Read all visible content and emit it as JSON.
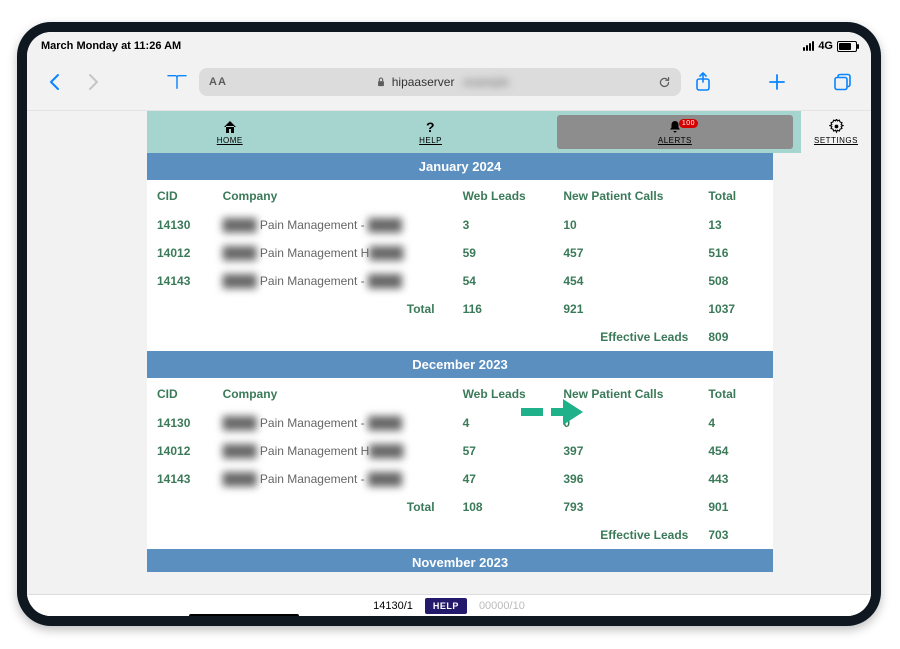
{
  "status": {
    "clock": "March Monday at 11:26 AM",
    "network": "4G"
  },
  "browser": {
    "domain": "hipaaserver"
  },
  "nav": {
    "home": "HOME",
    "help": "HELP",
    "alerts": "ALERTS",
    "alerts_badge": "100",
    "settings": "SETTINGS"
  },
  "columns": {
    "cid": "CID",
    "company": "Company",
    "web_leads": "Web Leads",
    "new_patient_calls": "New Patient Calls",
    "total": "Total"
  },
  "totals_label": "Total",
  "effective_label": "Effective Leads",
  "months": [
    {
      "title": "January 2024",
      "rows": [
        {
          "cid": "14130",
          "company_prefix": "████",
          "company_mid": " Pain Management - ",
          "company_suffix": "████",
          "web": "3",
          "new": "10",
          "total": "13"
        },
        {
          "cid": "14012",
          "company_prefix": "████",
          "company_mid": " Pain Management H",
          "company_suffix": "████",
          "web": "59",
          "new": "457",
          "total": "516"
        },
        {
          "cid": "14143",
          "company_prefix": "████",
          "company_mid": " Pain Management - ",
          "company_suffix": "████",
          "web": "54",
          "new": "454",
          "total": "508"
        }
      ],
      "totals": {
        "web": "116",
        "new": "921",
        "total": "1037"
      },
      "effective": "809"
    },
    {
      "title": "December 2023",
      "rows": [
        {
          "cid": "14130",
          "company_prefix": "████",
          "company_mid": " Pain Management - ",
          "company_suffix": "████",
          "web": "4",
          "new": "0",
          "total": "4"
        },
        {
          "cid": "14012",
          "company_prefix": "████",
          "company_mid": " Pain Management H",
          "company_suffix": "████",
          "web": "57",
          "new": "397",
          "total": "454"
        },
        {
          "cid": "14143",
          "company_prefix": "████",
          "company_mid": " Pain Management - ",
          "company_suffix": "████",
          "web": "47",
          "new": "396",
          "total": "443"
        }
      ],
      "totals": {
        "web": "108",
        "new": "793",
        "total": "901"
      },
      "effective": "703"
    },
    {
      "title": "November 2023",
      "rows": [],
      "totals": null,
      "effective": null
    }
  ],
  "footer": {
    "left": "14130/1",
    "help": "HELP",
    "right": "00000/10"
  }
}
